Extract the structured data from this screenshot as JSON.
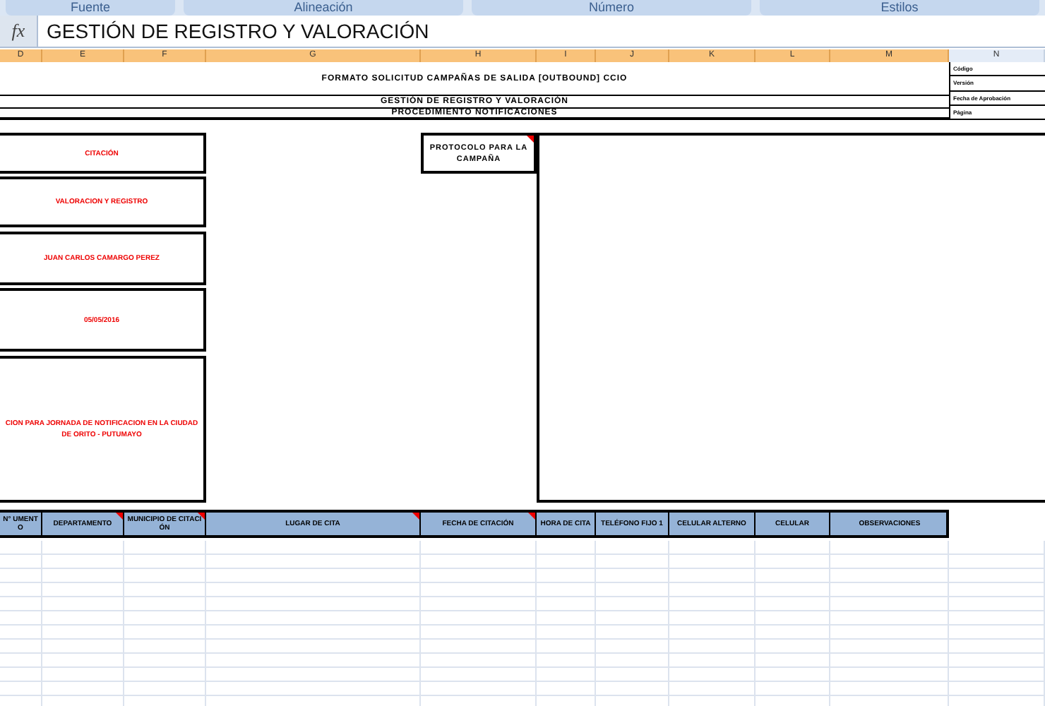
{
  "ribbon_groups": [
    "Fuente",
    "Alineación",
    "Número",
    "Estilos"
  ],
  "formula_bar": {
    "function_label": "fx",
    "content": "GESTIÓN DE REGISTRO Y VALORACIÓN"
  },
  "columns": [
    {
      "label": "D",
      "selected": true
    },
    {
      "label": "E",
      "selected": true
    },
    {
      "label": "F",
      "selected": true
    },
    {
      "label": "G",
      "selected": true
    },
    {
      "label": "H",
      "selected": true
    },
    {
      "label": "I",
      "selected": true
    },
    {
      "label": "J",
      "selected": true
    },
    {
      "label": "K",
      "selected": true
    },
    {
      "label": "L",
      "selected": true
    },
    {
      "label": "M",
      "selected": true
    },
    {
      "label": "N",
      "selected": false
    }
  ],
  "header": {
    "title": "FORMATO SOLICITUD CAMPAÑAS DE SALIDA [OUTBOUND] CCIO",
    "subtitle": "GESTIÓN DE REGISTRO Y VALORACIÓN",
    "procedure": "PROCEDIMIENTO NOTIFICACIONES"
  },
  "doc_info": [
    "Código",
    "Versión",
    "Fecha de Aprobación",
    "Página"
  ],
  "fields": [
    "CITACIÓN",
    "VALORACION Y REGISTRO",
    "JUAN CARLOS CAMARGO PEREZ",
    "05/05/2016",
    "CION PARA JORNADA DE NOTIFICACION EN LA CIUDAD DE ORITO - PUTUMAYO"
  ],
  "protocol": {
    "label": "PROTOCOLO  PARA LA CAMPAÑA",
    "comment": true
  },
  "table": {
    "columns": [
      {
        "label": "N° UMENT O",
        "comment": false
      },
      {
        "label": "DEPARTAMENTO",
        "comment": true
      },
      {
        "label": "MUNICIPIO DE CITACIÓN",
        "comment": true
      },
      {
        "label": "LUGAR DE CITA",
        "comment": true
      },
      {
        "label": "FECHA DE CITACIÓN",
        "comment": true
      },
      {
        "label": "HORA DE CITA",
        "comment": false
      },
      {
        "label": "TELÉFONO FIJO 1",
        "comment": false
      },
      {
        "label": "CELULAR ALTERNO",
        "comment": false
      },
      {
        "label": "CELULAR",
        "comment": false
      },
      {
        "label": "OBSERVACIONES",
        "comment": false
      }
    ]
  }
}
